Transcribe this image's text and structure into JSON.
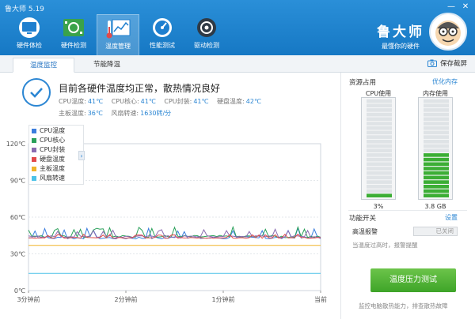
{
  "app": {
    "title": "鲁大师 5.19"
  },
  "window": {
    "min": "—",
    "close": "✕"
  },
  "nav": [
    {
      "label": "硬件体检",
      "icon": "monitor-check-icon"
    },
    {
      "label": "硬件检测",
      "icon": "circuit-board-icon"
    },
    {
      "label": "温度管理",
      "icon": "temperature-chart-icon",
      "active": true
    },
    {
      "label": "性能测试",
      "icon": "speedometer-icon"
    },
    {
      "label": "驱动检测",
      "icon": "driver-gear-icon"
    }
  ],
  "brand": {
    "name": "鲁大师",
    "slogan": "最懂你的硬件"
  },
  "tabs": [
    {
      "label": "温度监控",
      "active": true
    },
    {
      "label": "节能降温",
      "active": false
    }
  ],
  "save_report": "保存截屏",
  "status": {
    "main": "目前各硬件温度均正常，散热情况良好",
    "line1": [
      {
        "label": "CPU温度:",
        "value": "41℃"
      },
      {
        "label": "CPU核心:",
        "value": "41℃"
      },
      {
        "label": "CPU封装:",
        "value": "41℃"
      },
      {
        "label": "硬盘温度:",
        "value": "42℃"
      }
    ],
    "line2": [
      {
        "label": "主板温度:",
        "value": "36℃"
      },
      {
        "label": "风扇转速:",
        "value": "1630转/分"
      }
    ]
  },
  "chart_data": {
    "type": "line",
    "y_ticks": [
      "120℃",
      "90℃",
      "60℃",
      "30℃",
      "0℃"
    ],
    "ylim": [
      0,
      120
    ],
    "x_ticks": [
      "3分钟前",
      "2分钟前",
      "1分钟前",
      "当前"
    ],
    "grid": true,
    "legend_position": "top-left",
    "series": [
      {
        "name": "CPU温度",
        "color": "#3b7ddd",
        "base": 43,
        "noise": 5
      },
      {
        "name": "CPU核心",
        "color": "#2aa05a",
        "base": 44,
        "noise": 5
      },
      {
        "name": "CPU封装",
        "color": "#8a6bb0",
        "base": 44,
        "noise": 4
      },
      {
        "name": "硬盘温度",
        "color": "#e24a4a",
        "base": 43,
        "noise": 2
      },
      {
        "name": "主板温度",
        "color": "#f0b429",
        "base": 37,
        "noise": 0
      },
      {
        "name": "风扇转速",
        "color": "#4cc2e8",
        "base": 14,
        "noise": 0
      }
    ]
  },
  "right": {
    "resources_title": "资源占用",
    "optimize_link": "优化内存",
    "cpu_label": "CPU使用",
    "cpu_value": "3%",
    "cpu_pct": 3,
    "mem_label": "内存使用",
    "mem_value": "3.8 GB",
    "mem_pct": 47,
    "func_title": "功能开关",
    "settings_link": "设置",
    "alarm_label": "高温报警",
    "alarm_state": "已关闭",
    "alarm_desc": "当温度过高时，报警提醒",
    "stress_button": "温度压力测试",
    "stress_desc": "监控电脑散热能力，排查散热故障"
  }
}
